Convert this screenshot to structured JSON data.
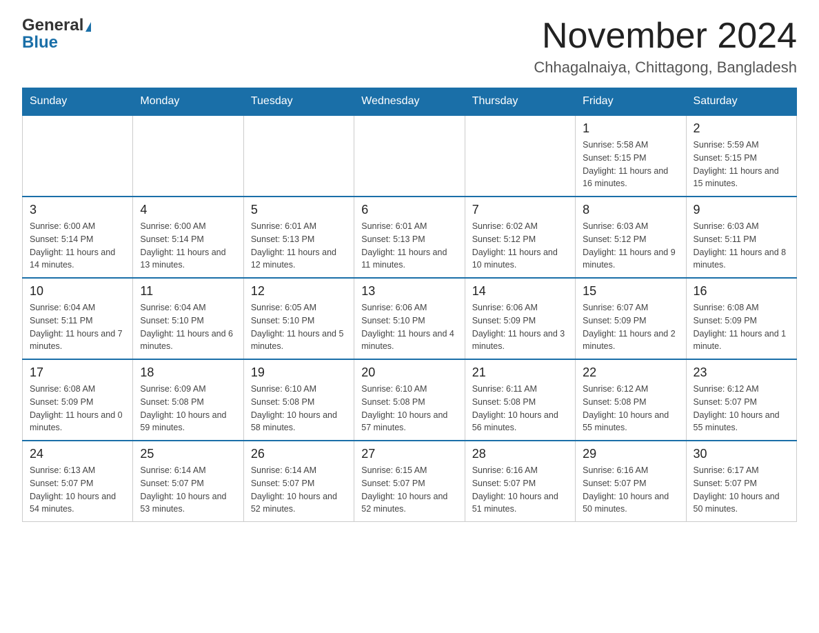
{
  "logo": {
    "general": "General",
    "triangle": "▶",
    "blue": "Blue"
  },
  "header": {
    "month_year": "November 2024",
    "location": "Chhagalnaiya, Chittagong, Bangladesh"
  },
  "weekdays": [
    "Sunday",
    "Monday",
    "Tuesday",
    "Wednesday",
    "Thursday",
    "Friday",
    "Saturday"
  ],
  "weeks": [
    [
      {
        "day": "",
        "sunrise": "",
        "sunset": "",
        "daylight": ""
      },
      {
        "day": "",
        "sunrise": "",
        "sunset": "",
        "daylight": ""
      },
      {
        "day": "",
        "sunrise": "",
        "sunset": "",
        "daylight": ""
      },
      {
        "day": "",
        "sunrise": "",
        "sunset": "",
        "daylight": ""
      },
      {
        "day": "",
        "sunrise": "",
        "sunset": "",
        "daylight": ""
      },
      {
        "day": "1",
        "sunrise": "Sunrise: 5:58 AM",
        "sunset": "Sunset: 5:15 PM",
        "daylight": "Daylight: 11 hours and 16 minutes."
      },
      {
        "day": "2",
        "sunrise": "Sunrise: 5:59 AM",
        "sunset": "Sunset: 5:15 PM",
        "daylight": "Daylight: 11 hours and 15 minutes."
      }
    ],
    [
      {
        "day": "3",
        "sunrise": "Sunrise: 6:00 AM",
        "sunset": "Sunset: 5:14 PM",
        "daylight": "Daylight: 11 hours and 14 minutes."
      },
      {
        "day": "4",
        "sunrise": "Sunrise: 6:00 AM",
        "sunset": "Sunset: 5:14 PM",
        "daylight": "Daylight: 11 hours and 13 minutes."
      },
      {
        "day": "5",
        "sunrise": "Sunrise: 6:01 AM",
        "sunset": "Sunset: 5:13 PM",
        "daylight": "Daylight: 11 hours and 12 minutes."
      },
      {
        "day": "6",
        "sunrise": "Sunrise: 6:01 AM",
        "sunset": "Sunset: 5:13 PM",
        "daylight": "Daylight: 11 hours and 11 minutes."
      },
      {
        "day": "7",
        "sunrise": "Sunrise: 6:02 AM",
        "sunset": "Sunset: 5:12 PM",
        "daylight": "Daylight: 11 hours and 10 minutes."
      },
      {
        "day": "8",
        "sunrise": "Sunrise: 6:03 AM",
        "sunset": "Sunset: 5:12 PM",
        "daylight": "Daylight: 11 hours and 9 minutes."
      },
      {
        "day": "9",
        "sunrise": "Sunrise: 6:03 AM",
        "sunset": "Sunset: 5:11 PM",
        "daylight": "Daylight: 11 hours and 8 minutes."
      }
    ],
    [
      {
        "day": "10",
        "sunrise": "Sunrise: 6:04 AM",
        "sunset": "Sunset: 5:11 PM",
        "daylight": "Daylight: 11 hours and 7 minutes."
      },
      {
        "day": "11",
        "sunrise": "Sunrise: 6:04 AM",
        "sunset": "Sunset: 5:10 PM",
        "daylight": "Daylight: 11 hours and 6 minutes."
      },
      {
        "day": "12",
        "sunrise": "Sunrise: 6:05 AM",
        "sunset": "Sunset: 5:10 PM",
        "daylight": "Daylight: 11 hours and 5 minutes."
      },
      {
        "day": "13",
        "sunrise": "Sunrise: 6:06 AM",
        "sunset": "Sunset: 5:10 PM",
        "daylight": "Daylight: 11 hours and 4 minutes."
      },
      {
        "day": "14",
        "sunrise": "Sunrise: 6:06 AM",
        "sunset": "Sunset: 5:09 PM",
        "daylight": "Daylight: 11 hours and 3 minutes."
      },
      {
        "day": "15",
        "sunrise": "Sunrise: 6:07 AM",
        "sunset": "Sunset: 5:09 PM",
        "daylight": "Daylight: 11 hours and 2 minutes."
      },
      {
        "day": "16",
        "sunrise": "Sunrise: 6:08 AM",
        "sunset": "Sunset: 5:09 PM",
        "daylight": "Daylight: 11 hours and 1 minute."
      }
    ],
    [
      {
        "day": "17",
        "sunrise": "Sunrise: 6:08 AM",
        "sunset": "Sunset: 5:09 PM",
        "daylight": "Daylight: 11 hours and 0 minutes."
      },
      {
        "day": "18",
        "sunrise": "Sunrise: 6:09 AM",
        "sunset": "Sunset: 5:08 PM",
        "daylight": "Daylight: 10 hours and 59 minutes."
      },
      {
        "day": "19",
        "sunrise": "Sunrise: 6:10 AM",
        "sunset": "Sunset: 5:08 PM",
        "daylight": "Daylight: 10 hours and 58 minutes."
      },
      {
        "day": "20",
        "sunrise": "Sunrise: 6:10 AM",
        "sunset": "Sunset: 5:08 PM",
        "daylight": "Daylight: 10 hours and 57 minutes."
      },
      {
        "day": "21",
        "sunrise": "Sunrise: 6:11 AM",
        "sunset": "Sunset: 5:08 PM",
        "daylight": "Daylight: 10 hours and 56 minutes."
      },
      {
        "day": "22",
        "sunrise": "Sunrise: 6:12 AM",
        "sunset": "Sunset: 5:08 PM",
        "daylight": "Daylight: 10 hours and 55 minutes."
      },
      {
        "day": "23",
        "sunrise": "Sunrise: 6:12 AM",
        "sunset": "Sunset: 5:07 PM",
        "daylight": "Daylight: 10 hours and 55 minutes."
      }
    ],
    [
      {
        "day": "24",
        "sunrise": "Sunrise: 6:13 AM",
        "sunset": "Sunset: 5:07 PM",
        "daylight": "Daylight: 10 hours and 54 minutes."
      },
      {
        "day": "25",
        "sunrise": "Sunrise: 6:14 AM",
        "sunset": "Sunset: 5:07 PM",
        "daylight": "Daylight: 10 hours and 53 minutes."
      },
      {
        "day": "26",
        "sunrise": "Sunrise: 6:14 AM",
        "sunset": "Sunset: 5:07 PM",
        "daylight": "Daylight: 10 hours and 52 minutes."
      },
      {
        "day": "27",
        "sunrise": "Sunrise: 6:15 AM",
        "sunset": "Sunset: 5:07 PM",
        "daylight": "Daylight: 10 hours and 52 minutes."
      },
      {
        "day": "28",
        "sunrise": "Sunrise: 6:16 AM",
        "sunset": "Sunset: 5:07 PM",
        "daylight": "Daylight: 10 hours and 51 minutes."
      },
      {
        "day": "29",
        "sunrise": "Sunrise: 6:16 AM",
        "sunset": "Sunset: 5:07 PM",
        "daylight": "Daylight: 10 hours and 50 minutes."
      },
      {
        "day": "30",
        "sunrise": "Sunrise: 6:17 AM",
        "sunset": "Sunset: 5:07 PM",
        "daylight": "Daylight: 10 hours and 50 minutes."
      }
    ]
  ]
}
